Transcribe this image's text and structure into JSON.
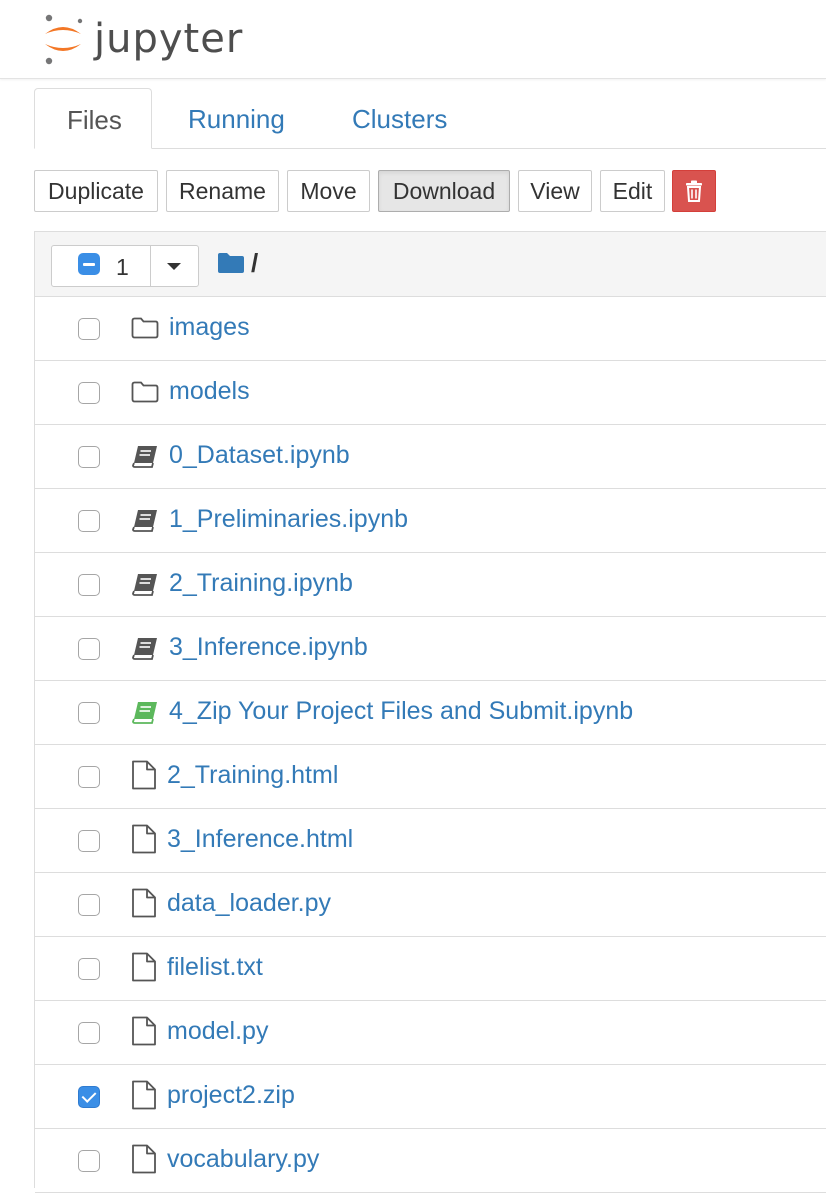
{
  "header": {
    "logo_text": "jupyter"
  },
  "tabs": [
    {
      "label": "Files",
      "active": true
    },
    {
      "label": "Running",
      "active": false
    },
    {
      "label": "Clusters",
      "active": false
    }
  ],
  "toolbar": {
    "duplicate_label": "Duplicate",
    "rename_label": "Rename",
    "move_label": "Move",
    "download_label": "Download",
    "view_label": "View",
    "edit_label": "Edit",
    "delete_icon": "trash-icon"
  },
  "list_header": {
    "selected_count": "1",
    "path": "/"
  },
  "colors": {
    "link": "#337ab7",
    "danger": "#d9534f",
    "checkbox_checked": "#3a8ee6",
    "running_notebook": "#5cb85c",
    "logo_orange": "#f37726"
  },
  "files": [
    {
      "name": "images",
      "type": "folder",
      "checked": false
    },
    {
      "name": "models",
      "type": "folder",
      "checked": false
    },
    {
      "name": "0_Dataset.ipynb",
      "type": "notebook",
      "running": false,
      "checked": false
    },
    {
      "name": "1_Preliminaries.ipynb",
      "type": "notebook",
      "running": false,
      "checked": false
    },
    {
      "name": "2_Training.ipynb",
      "type": "notebook",
      "running": false,
      "checked": false
    },
    {
      "name": "3_Inference.ipynb",
      "type": "notebook",
      "running": false,
      "checked": false
    },
    {
      "name": "4_Zip Your Project Files and Submit.ipynb",
      "type": "notebook",
      "running": true,
      "checked": false
    },
    {
      "name": "2_Training.html",
      "type": "file",
      "checked": false
    },
    {
      "name": "3_Inference.html",
      "type": "file",
      "checked": false
    },
    {
      "name": "data_loader.py",
      "type": "file",
      "checked": false
    },
    {
      "name": "filelist.txt",
      "type": "file",
      "checked": false
    },
    {
      "name": "model.py",
      "type": "file",
      "checked": false
    },
    {
      "name": "project2.zip",
      "type": "file",
      "checked": true
    },
    {
      "name": "vocabulary.py",
      "type": "file",
      "checked": false
    }
  ]
}
